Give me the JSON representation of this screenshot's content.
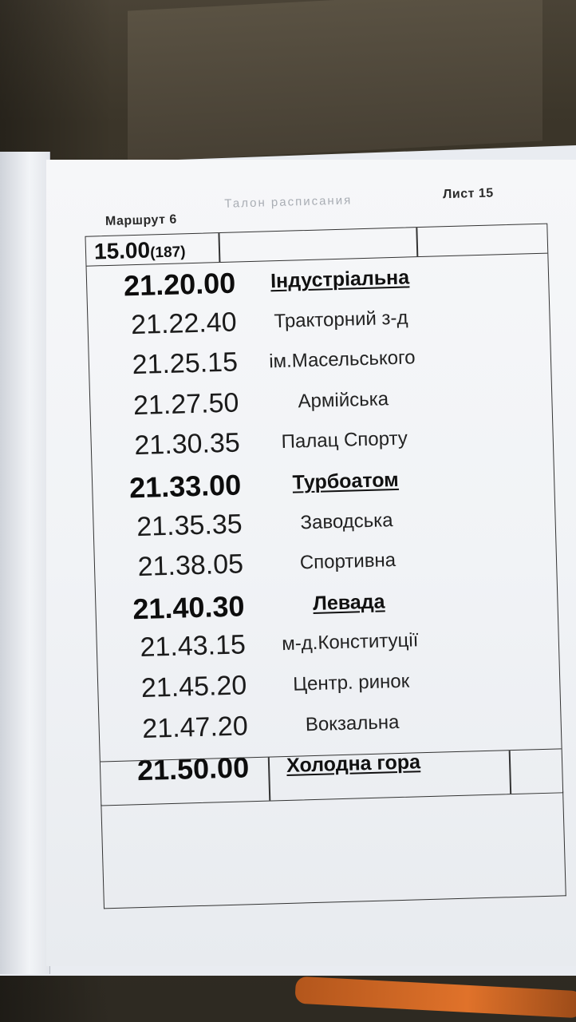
{
  "header": {
    "route": "Маршрут 6",
    "title": "Талон расписания",
    "sheet": "Лист 15"
  },
  "start": {
    "time": "15.00",
    "count": "(187)"
  },
  "rows": [
    {
      "time": "21.20.00",
      "stop": "Індустріальна",
      "key": true
    },
    {
      "time": "21.22.40",
      "stop": "Тракторний з-д",
      "key": false
    },
    {
      "time": "21.25.15",
      "stop": "ім.Масельського",
      "key": false
    },
    {
      "time": "21.27.50",
      "stop": "Армійська",
      "key": false
    },
    {
      "time": "21.30.35",
      "stop": "Палац Спорту",
      "key": false
    },
    {
      "time": "21.33.00",
      "stop": "Турбоатом",
      "key": true
    },
    {
      "time": "21.35.35",
      "stop": "Заводська",
      "key": false
    },
    {
      "time": "21.38.05",
      "stop": "Спортивна",
      "key": false
    },
    {
      "time": "21.40.30",
      "stop": "Левада",
      "key": true
    },
    {
      "time": "21.43.15",
      "stop": "м-д.Конституції",
      "key": false
    },
    {
      "time": "21.45.20",
      "stop": "Центр. ринок",
      "key": false
    },
    {
      "time": "21.47.20",
      "stop": "Вокзальна",
      "key": false
    },
    {
      "time": "21.50.00",
      "stop": "Холодна гора",
      "key": true
    }
  ]
}
